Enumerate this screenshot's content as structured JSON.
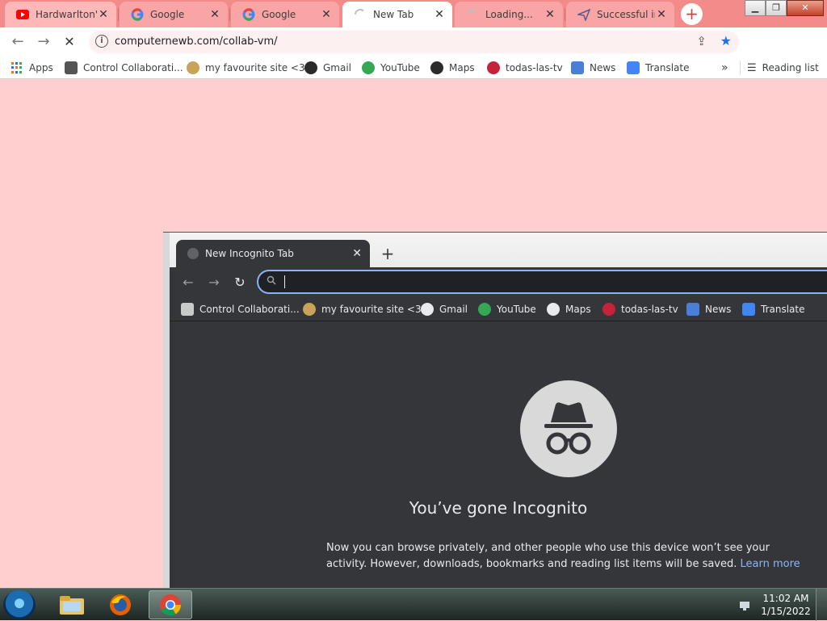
{
  "browser": {
    "tabs": [
      {
        "title": "Hardwarlton'",
        "icon": "youtube-icon"
      },
      {
        "title": "Google",
        "icon": "google-icon"
      },
      {
        "title": "Google",
        "icon": "google-icon"
      },
      {
        "title": "New Tab",
        "icon": "loading-spinner-icon"
      },
      {
        "title": "Loading...",
        "icon": "loading-spinner-icon"
      },
      {
        "title": "Successful in",
        "icon": "paper-plane-icon"
      }
    ],
    "url": "computernewb.com/collab-vm/",
    "bookmarks": [
      {
        "label": "Apps"
      },
      {
        "label": "Control Collaborati..."
      },
      {
        "label": "my favourite site <3"
      },
      {
        "label": "Gmail"
      },
      {
        "label": "YouTube"
      },
      {
        "label": "Maps"
      },
      {
        "label": "todas-las-tv"
      },
      {
        "label": "News"
      },
      {
        "label": "Translate"
      }
    ],
    "overflow_label": "»",
    "reading_list": "Reading list"
  },
  "incognito": {
    "tab_title": "New Incognito Tab",
    "bookmarks": [
      {
        "label": "Control Collaborati..."
      },
      {
        "label": "my favourite site <3"
      },
      {
        "label": "Gmail"
      },
      {
        "label": "YouTube"
      },
      {
        "label": "Maps"
      },
      {
        "label": "todas-las-tv"
      },
      {
        "label": "News"
      },
      {
        "label": "Translate"
      }
    ],
    "heading": "You’ve gone Incognito",
    "description": "Now you can browse privately, and other people who use this device won’t see your activity. However, downloads, bookmarks and reading list items will be saved.",
    "learn_more": "Learn more"
  },
  "taskbar": {
    "time": "11:02 AM",
    "date": "1/15/2022"
  },
  "colors": {
    "tabstrip": "#f38b8b",
    "page_background": "#ffcfcf",
    "incognito_background": "#35363a",
    "accent_blue": "#1a73e8",
    "link_blue": "#8ab4f8"
  }
}
